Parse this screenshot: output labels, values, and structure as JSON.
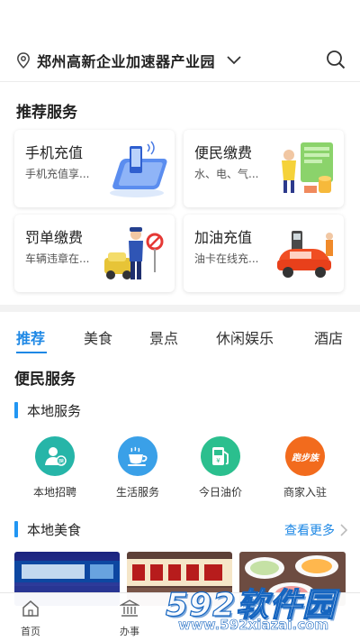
{
  "header": {
    "location": "郑州高新企业加速器产业园",
    "location_icon": "location-pin-icon",
    "search_icon": "search-icon"
  },
  "recommended": {
    "title": "推荐服务",
    "cards": [
      {
        "title": "手机充值",
        "desc": "手机充值享..."
      },
      {
        "title": "便民缴费",
        "desc": "水、电、气..."
      },
      {
        "title": "罚单缴费",
        "desc": "车辆违章在..."
      },
      {
        "title": "加油充值",
        "desc": "油卡在线充..."
      }
    ]
  },
  "tabs": [
    "推荐",
    "美食",
    "景点",
    "休闲娱乐",
    "酒店"
  ],
  "convenience": {
    "title": "便民服务",
    "local_services_title": "本地服务",
    "services": [
      {
        "label": "本地招聘",
        "icon": "recruit-icon",
        "color": "#26b5a8"
      },
      {
        "label": "生活服务",
        "icon": "coffee-icon",
        "color": "#3aa0e8"
      },
      {
        "label": "今日油价",
        "icon": "fuel-icon",
        "color": "#2bbf8e"
      },
      {
        "label": "商家入驻",
        "icon": "merchant-icon",
        "color": "#f26b1d",
        "badge": "跑步族"
      }
    ],
    "local_food_title": "本地美食",
    "see_more": "查看更多"
  },
  "bottom_nav": [
    {
      "label": "首页",
      "icon": "home-icon"
    },
    {
      "label": "办事",
      "icon": "government-icon"
    }
  ],
  "watermark": {
    "brand": "592软件园",
    "url": "www.592xiazai.com"
  },
  "colors": {
    "accent": "#1e88e5"
  }
}
